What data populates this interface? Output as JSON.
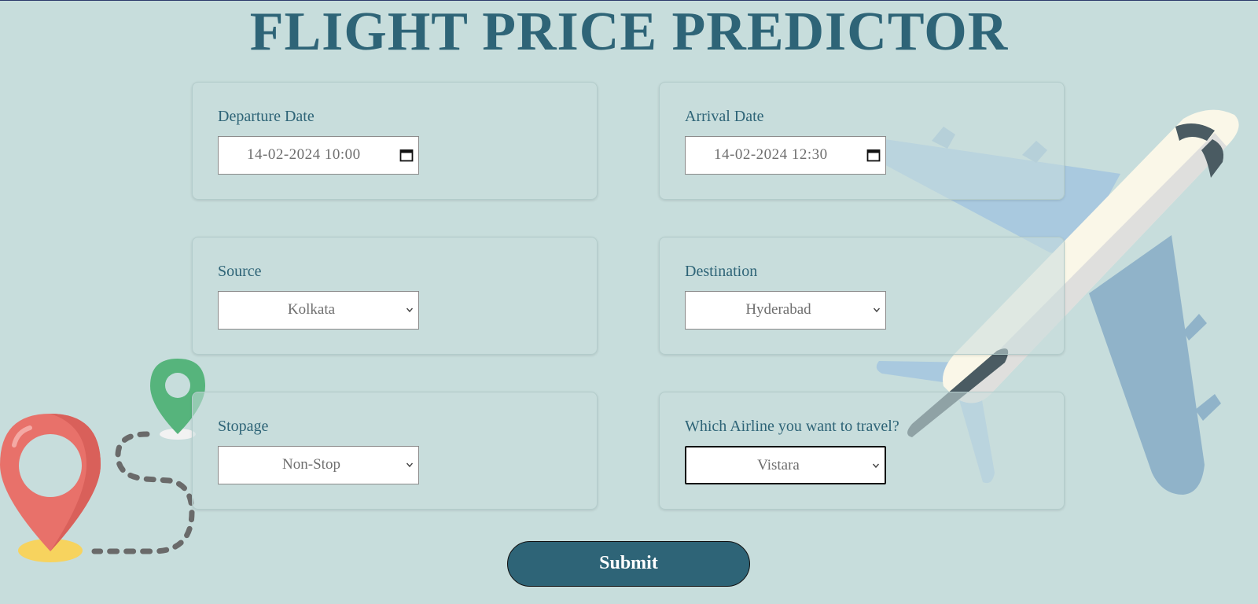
{
  "page": {
    "title": "FLIGHT PRICE PREDICTOR"
  },
  "form": {
    "departure": {
      "label": "Departure Date",
      "value": "14-02-2024 10:00"
    },
    "arrival": {
      "label": "Arrival Date",
      "value": "14-02-2024 12:30"
    },
    "source": {
      "label": "Source",
      "value": "Kolkata"
    },
    "destination": {
      "label": "Destination",
      "value": "Hyderabad"
    },
    "stopage": {
      "label": "Stopage",
      "value": "Non-Stop"
    },
    "airline": {
      "label": "Which Airline you want to travel?",
      "value": "Vistara"
    },
    "submit_label": "Submit"
  },
  "icons": {
    "calendar": "calendar-icon",
    "dropdown": "chevron-down-icon",
    "airplane": "airplane-illustration",
    "pin_red": "map-pin-icon",
    "pin_green": "map-pin-icon"
  },
  "colors": {
    "background": "#c7dddc",
    "accent": "#2e6477",
    "pin_red": "#e8716a",
    "pin_green": "#56b47c",
    "pin_base": "#f7d35e",
    "plane_body": "#faf7e8",
    "plane_wing": "#a9c9df",
    "plane_wing_dark": "#90b3c9",
    "plane_cockpit": "#4a5b62"
  }
}
